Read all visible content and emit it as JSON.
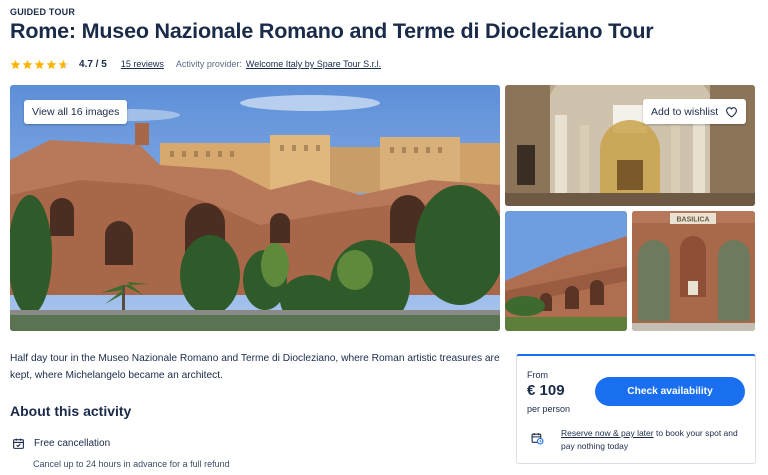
{
  "header": {
    "kicker": "GUIDED TOUR",
    "title": "Rome: Museo Nazionale Romano and Terme di Diocleziano Tour"
  },
  "rating": {
    "stars": 4.7,
    "score": "4.7 / 5",
    "reviews": "15 reviews",
    "provider_label": "Activity provider:",
    "provider_name": "Welcome Italy by Spare Tour S.r.l."
  },
  "gallery": {
    "view_all": "View all 16 images",
    "wishlist": "Add to wishlist",
    "thumb_sign": "BASILICA"
  },
  "summary": "Half day tour in the Museo Nazionale Romano and Terme di Diocleziano, where Roman artistic treasures are kept, where Michelangelo became an architect.",
  "about": {
    "heading": "About this activity",
    "features": [
      {
        "title": "Free cancellation",
        "subtitle": "Cancel up to 24 hours in advance for a full refund"
      }
    ]
  },
  "booking": {
    "from_label": "From",
    "price": "€ 109",
    "per_label": "per person",
    "check_button": "Check availability",
    "reserve_link": "Reserve now & pay later",
    "reserve_text": " to book your spot and pay nothing today"
  },
  "colors": {
    "primary": "#1a6ff0",
    "text": "#1a2b49",
    "star": "#ffb400"
  }
}
